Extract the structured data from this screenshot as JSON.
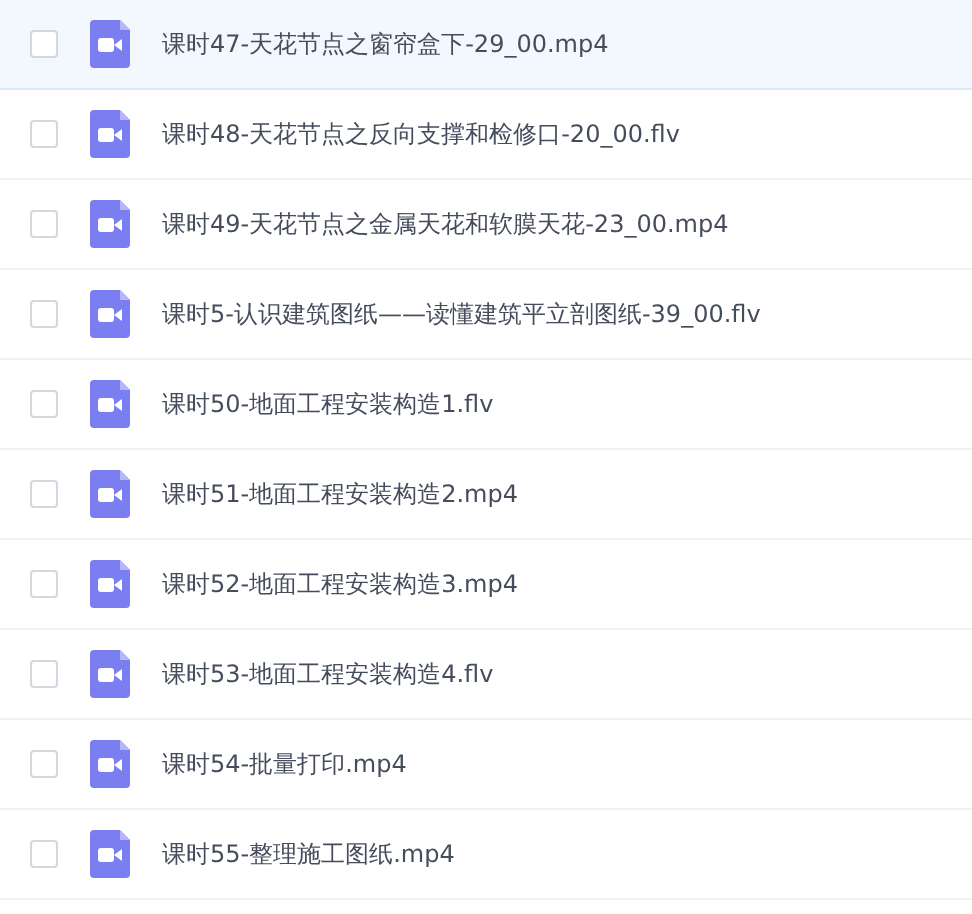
{
  "files": [
    {
      "name": "课时47-天花节点之窗帘盒下-29_00.mp4",
      "selected": true,
      "checked": false
    },
    {
      "name": "课时48-天花节点之反向支撑和检修口-20_00.flv",
      "selected": false,
      "checked": false
    },
    {
      "name": "课时49-天花节点之金属天花和软膜天花-23_00.mp4",
      "selected": false,
      "checked": false
    },
    {
      "name": "课时5-认识建筑图纸——读懂建筑平立剖图纸-39_00.flv",
      "selected": false,
      "checked": false
    },
    {
      "name": "课时50-地面工程安装构造1.flv",
      "selected": false,
      "checked": false
    },
    {
      "name": "课时51-地面工程安装构造2.mp4",
      "selected": false,
      "checked": false
    },
    {
      "name": "课时52-地面工程安装构造3.mp4",
      "selected": false,
      "checked": false
    },
    {
      "name": "课时53-地面工程安装构造4.flv",
      "selected": false,
      "checked": false
    },
    {
      "name": "课时54-批量打印.mp4",
      "selected": false,
      "checked": false
    },
    {
      "name": "课时55-整理施工图纸.mp4",
      "selected": false,
      "checked": false
    }
  ]
}
